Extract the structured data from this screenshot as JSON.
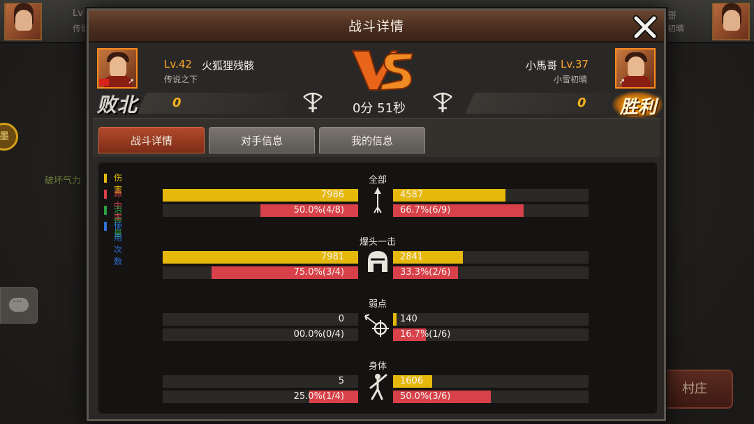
{
  "background": {
    "left_lv_fragment": "Lv",
    "left_title_fragment": "传说",
    "right_name_fragment": "哥",
    "right_title_fragment": "初晴",
    "medal_char": "墨",
    "break_label": "破坏气力",
    "village_label": "村庄"
  },
  "modal": {
    "title": "战斗详情"
  },
  "players": {
    "left": {
      "level": "Lv.42",
      "name": "火狐狸残骸",
      "title": "传说之下",
      "score": "0",
      "result": "败北"
    },
    "right": {
      "level": "Lv.37",
      "name": "小馬哥",
      "title": "小雪初晴",
      "score": "0",
      "result": "胜利"
    }
  },
  "match": {
    "timer": "0分 51秒"
  },
  "tabs": [
    {
      "label": "战斗详情",
      "active": true
    },
    {
      "label": "对手信息",
      "active": false
    },
    {
      "label": "我的信息",
      "active": false
    }
  ],
  "legend": [
    {
      "label": "伤害",
      "color": "#e6b80c"
    },
    {
      "label": "命中率",
      "color": "#d8414a"
    },
    {
      "label": "治疗量",
      "color": "#2ea043"
    },
    {
      "label": "使用次数",
      "color": "#2f6fd6"
    }
  ],
  "categories": [
    {
      "title": "全部",
      "icon": "arrow-icon",
      "left": {
        "damage": "7986",
        "damage_ratio": 1.0,
        "hit": "50.0%(4/8)",
        "hit_rate": 0.5
      },
      "right": {
        "damage": "4587",
        "damage_ratio": 0.574,
        "hit": "66.7%(6/9)",
        "hit_rate": 0.667
      }
    },
    {
      "title": "爆头一击",
      "icon": "helmet-icon",
      "left": {
        "damage": "7981",
        "damage_ratio": 1.0,
        "hit": "75.0%(3/4)",
        "hit_rate": 0.75
      },
      "right": {
        "damage": "2841",
        "damage_ratio": 0.356,
        "hit": "33.3%(2/6)",
        "hit_rate": 0.333
      }
    },
    {
      "title": "弱点",
      "icon": "weakpoint-icon",
      "left": {
        "damage": "0",
        "damage_ratio": 0.0,
        "hit": "00.0%(0/4)",
        "hit_rate": 0.0
      },
      "right": {
        "damage": "140",
        "damage_ratio": 0.018,
        "hit": "16.7%(1/6)",
        "hit_rate": 0.167
      }
    },
    {
      "title": "身体",
      "icon": "body-icon",
      "left": {
        "damage": "5",
        "damage_ratio": 0.0,
        "hit": "25.0%(1/4)",
        "hit_rate": 0.25
      },
      "right": {
        "damage": "1606",
        "damage_ratio": 0.201,
        "hit": "50.0%(3/6)",
        "hit_rate": 0.5
      }
    }
  ]
}
